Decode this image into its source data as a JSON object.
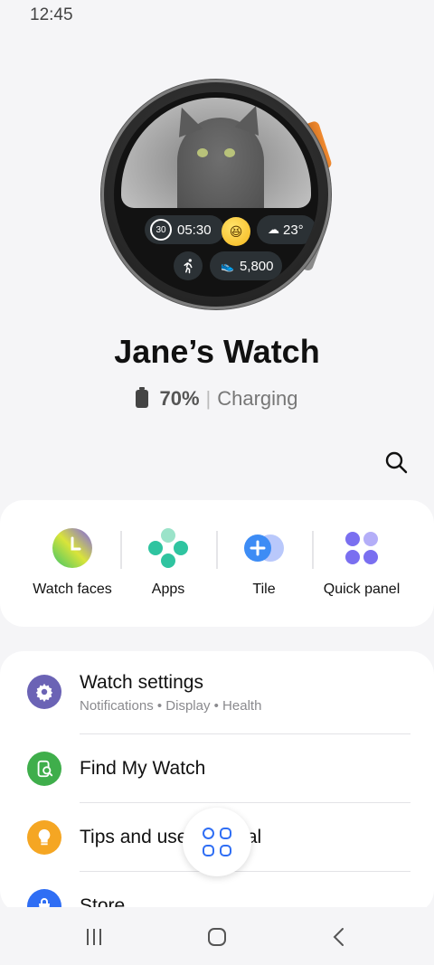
{
  "status_bar": {
    "time": "12:45"
  },
  "watch_face": {
    "timer_value": "30",
    "timer_time": "05:30",
    "weather_temp": "23°",
    "steps": "5,800",
    "emoji": "😆"
  },
  "device": {
    "name": "Jane’s Watch",
    "battery_percent": "70%",
    "battery_separator": "|",
    "battery_status": "Charging"
  },
  "quick_actions": [
    {
      "label": "Watch faces",
      "icon": "watch-faces-icon"
    },
    {
      "label": "Apps",
      "icon": "apps-icon"
    },
    {
      "label": "Tile",
      "icon": "tile-icon"
    },
    {
      "label": "Quick panel",
      "icon": "quick-panel-icon"
    }
  ],
  "settings_list": [
    {
      "title": "Watch settings",
      "subtitle": "Notifications • Display • Health",
      "icon": "gear-icon",
      "color": "#6b63b5"
    },
    {
      "title": "Find My Watch",
      "subtitle": "",
      "icon": "find-watch-icon",
      "color": "#3fae4b"
    },
    {
      "title": "Tips and user manual",
      "subtitle": "",
      "icon": "lightbulb-icon",
      "color": "#f5a623"
    },
    {
      "title": "Store",
      "subtitle": "",
      "icon": "store-bag-icon",
      "color": "#2f6ef4"
    }
  ],
  "colors": {
    "accent": "#2f6ef4",
    "background": "#f5f5f7",
    "card": "#ffffff"
  }
}
